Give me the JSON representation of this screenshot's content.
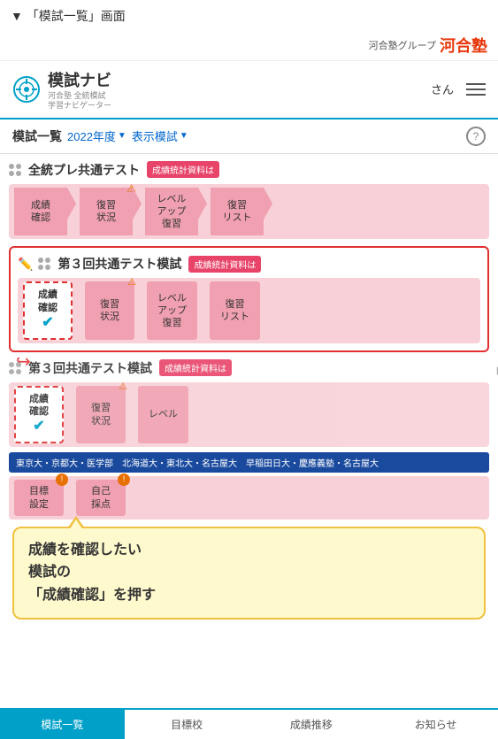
{
  "page": {
    "title": "「模試一覧」画面",
    "triangle": "▼"
  },
  "kawai_header": {
    "group_label": "河合塾グループ",
    "brand": "河合塾"
  },
  "app_header": {
    "logo_main": "模試ナビ",
    "logo_sub1": "河合塾 全統模試",
    "logo_sub2": "学習ナビゲーター",
    "user_suffix": "さん"
  },
  "filter_bar": {
    "label": "模試一覧",
    "year": "2022年度",
    "display": "表示模試",
    "help": "?"
  },
  "exam1": {
    "title": "全統プレ共通テスト",
    "badge": "成績統計資料は",
    "btn1_line1": "成績",
    "btn1_line2": "確認",
    "btn2_line1": "復習",
    "btn2_line2": "状況",
    "btn3_line1": "レベル",
    "btn3_line2": "アップ",
    "btn3_line3": "復習",
    "btn4_line1": "復習",
    "btn4_line2": "リスト"
  },
  "exam2": {
    "title": "第３回共通テスト模試",
    "badge": "成績統計資料は",
    "seiseki_line1": "成績",
    "seiseki_line2": "確認",
    "btn2_line1": "復習",
    "btn2_line2": "状況",
    "btn3_line1": "レベル",
    "btn3_line2": "アップ",
    "btn3_line3": "復習",
    "btn4_line1": "復習",
    "btn4_line2": "リスト"
  },
  "exam3": {
    "title": "第３回共通テスト模試",
    "badge": "成績統計資料は",
    "seiseki_line1": "成績",
    "seiseki_line2": "確認",
    "btn2_line1": "復習",
    "btn2_line2": "状況"
  },
  "uni_bar": {
    "text": "東京大・京都大・医学部　北海道大・東北大・名古屋大　早稲田日大・慶應義塾・名古屋大"
  },
  "targets": {
    "btn1_line1": "目標",
    "btn1_line2": "設定",
    "btn2_line1": "自己",
    "btn2_line2": "採点"
  },
  "tooltip": {
    "line1": "成績を確認したい",
    "line2": "模試の",
    "line3": "「成績確認」を押す"
  },
  "bottom_nav": {
    "item1": "模試一覧",
    "item2": "目標校",
    "item3": "成績推移",
    "item4": "お知らせ"
  }
}
